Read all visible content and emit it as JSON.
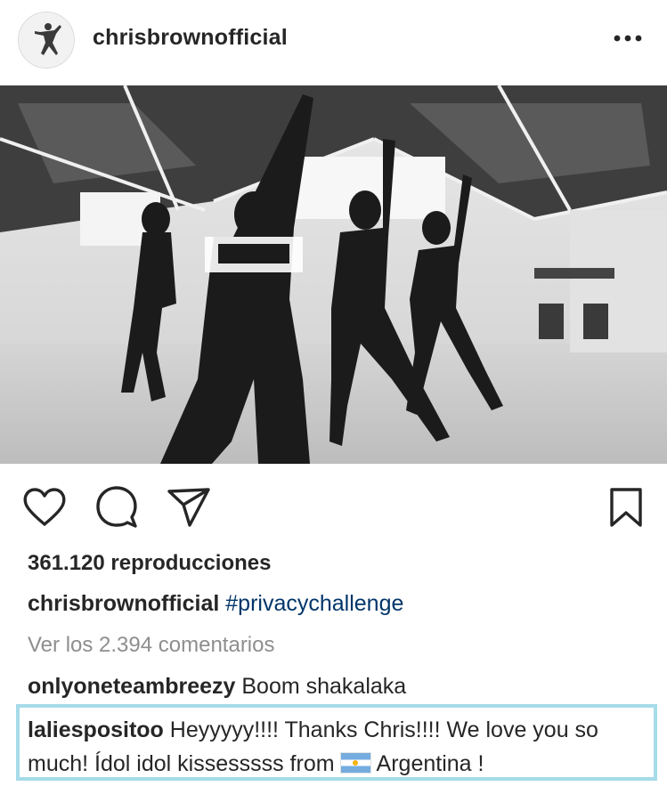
{
  "header": {
    "username": "chrisbrownofficial",
    "avatar_icon": "dancer-silhouette-icon",
    "more_icon": "more-dots-icon"
  },
  "media": {
    "type": "video",
    "description_icon": "dance-studio-video"
  },
  "actions": {
    "like_icon": "heart-icon",
    "comment_icon": "comment-bubble-icon",
    "share_icon": "paper-plane-icon",
    "save_icon": "bookmark-icon"
  },
  "stats": {
    "views": "361.120 reproducciones"
  },
  "caption": {
    "username": "chrisbrownofficial",
    "hashtag": "#privacychallenge"
  },
  "comments_link": "Ver los 2.394 comentarios",
  "comments": [
    {
      "username": "onlyoneteambreezy",
      "text": "Boom shakalaka"
    },
    {
      "username": "laliespositoo",
      "text_before_flag": "Heyyyyy!!!! Thanks Chris!!!! We love you so much! Ídol idol kissesssss from",
      "flag_icon": "argentina-flag-icon",
      "text_after_flag": "Argentina !",
      "highlight_color": "#a6dbe9"
    }
  ],
  "colors": {
    "text": "#262626",
    "muted": "#8e8e8e",
    "hashtag": "#003569"
  }
}
